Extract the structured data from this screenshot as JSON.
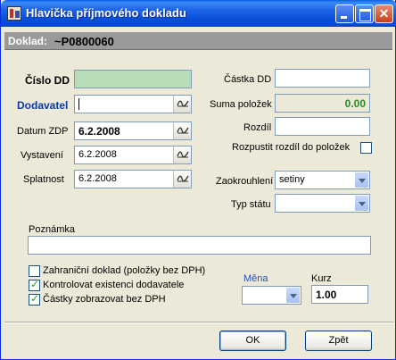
{
  "window": {
    "title": "Hlavička příjmového dokladu"
  },
  "doc": {
    "label": "Doklad:",
    "value": "~P0800060"
  },
  "left": {
    "cislo_dd_label": "Číslo DD",
    "cislo_dd_value": "",
    "dodavatel_label": "Dodavatel",
    "dodavatel_value": "",
    "datum_zdp_label": "Datum ZDP",
    "datum_zdp_value": "6.2.2008",
    "vystaveni_label": "Vystavení",
    "vystaveni_value": "6.2.2008",
    "splatnost_label": "Splatnost",
    "splatnost_value": "6.2.2008"
  },
  "right": {
    "castka_dd_label": "Částka DD",
    "castka_dd_value": "",
    "suma_polozek_label": "Suma položek",
    "suma_polozek_value": "0.00",
    "rozdil_label": "Rozdíl",
    "rozdil_value": "",
    "rozpustit_label": "Rozpustit rozdíl do položek",
    "zaokrouhleni_label": "Zaokrouhlení",
    "zaokrouhleni_value": "setiny",
    "typ_statu_label": "Typ státu",
    "typ_statu_value": ""
  },
  "poznamka": {
    "label": "Poznámka",
    "value": ""
  },
  "options": [
    {
      "label": "Zahraniční doklad (položky bez DPH)",
      "checked": false
    },
    {
      "label": "Kontrolovat existenci dodavatele",
      "checked": true
    },
    {
      "label": "Částky zobrazovat bez DPH",
      "checked": true
    }
  ],
  "currency": {
    "mena_label": "Měna",
    "mena_value": "",
    "kurz_label": "Kurz",
    "kurz_value": "1.00"
  },
  "buttons": {
    "ok": "OK",
    "cancel": "Zpět"
  },
  "colors": {
    "title_bar": "#0a4fd8",
    "doc_strip": "#9a9a9a",
    "cislo_dd_bg": "#b9dcb9",
    "suma_text": "#2a8a2a"
  }
}
